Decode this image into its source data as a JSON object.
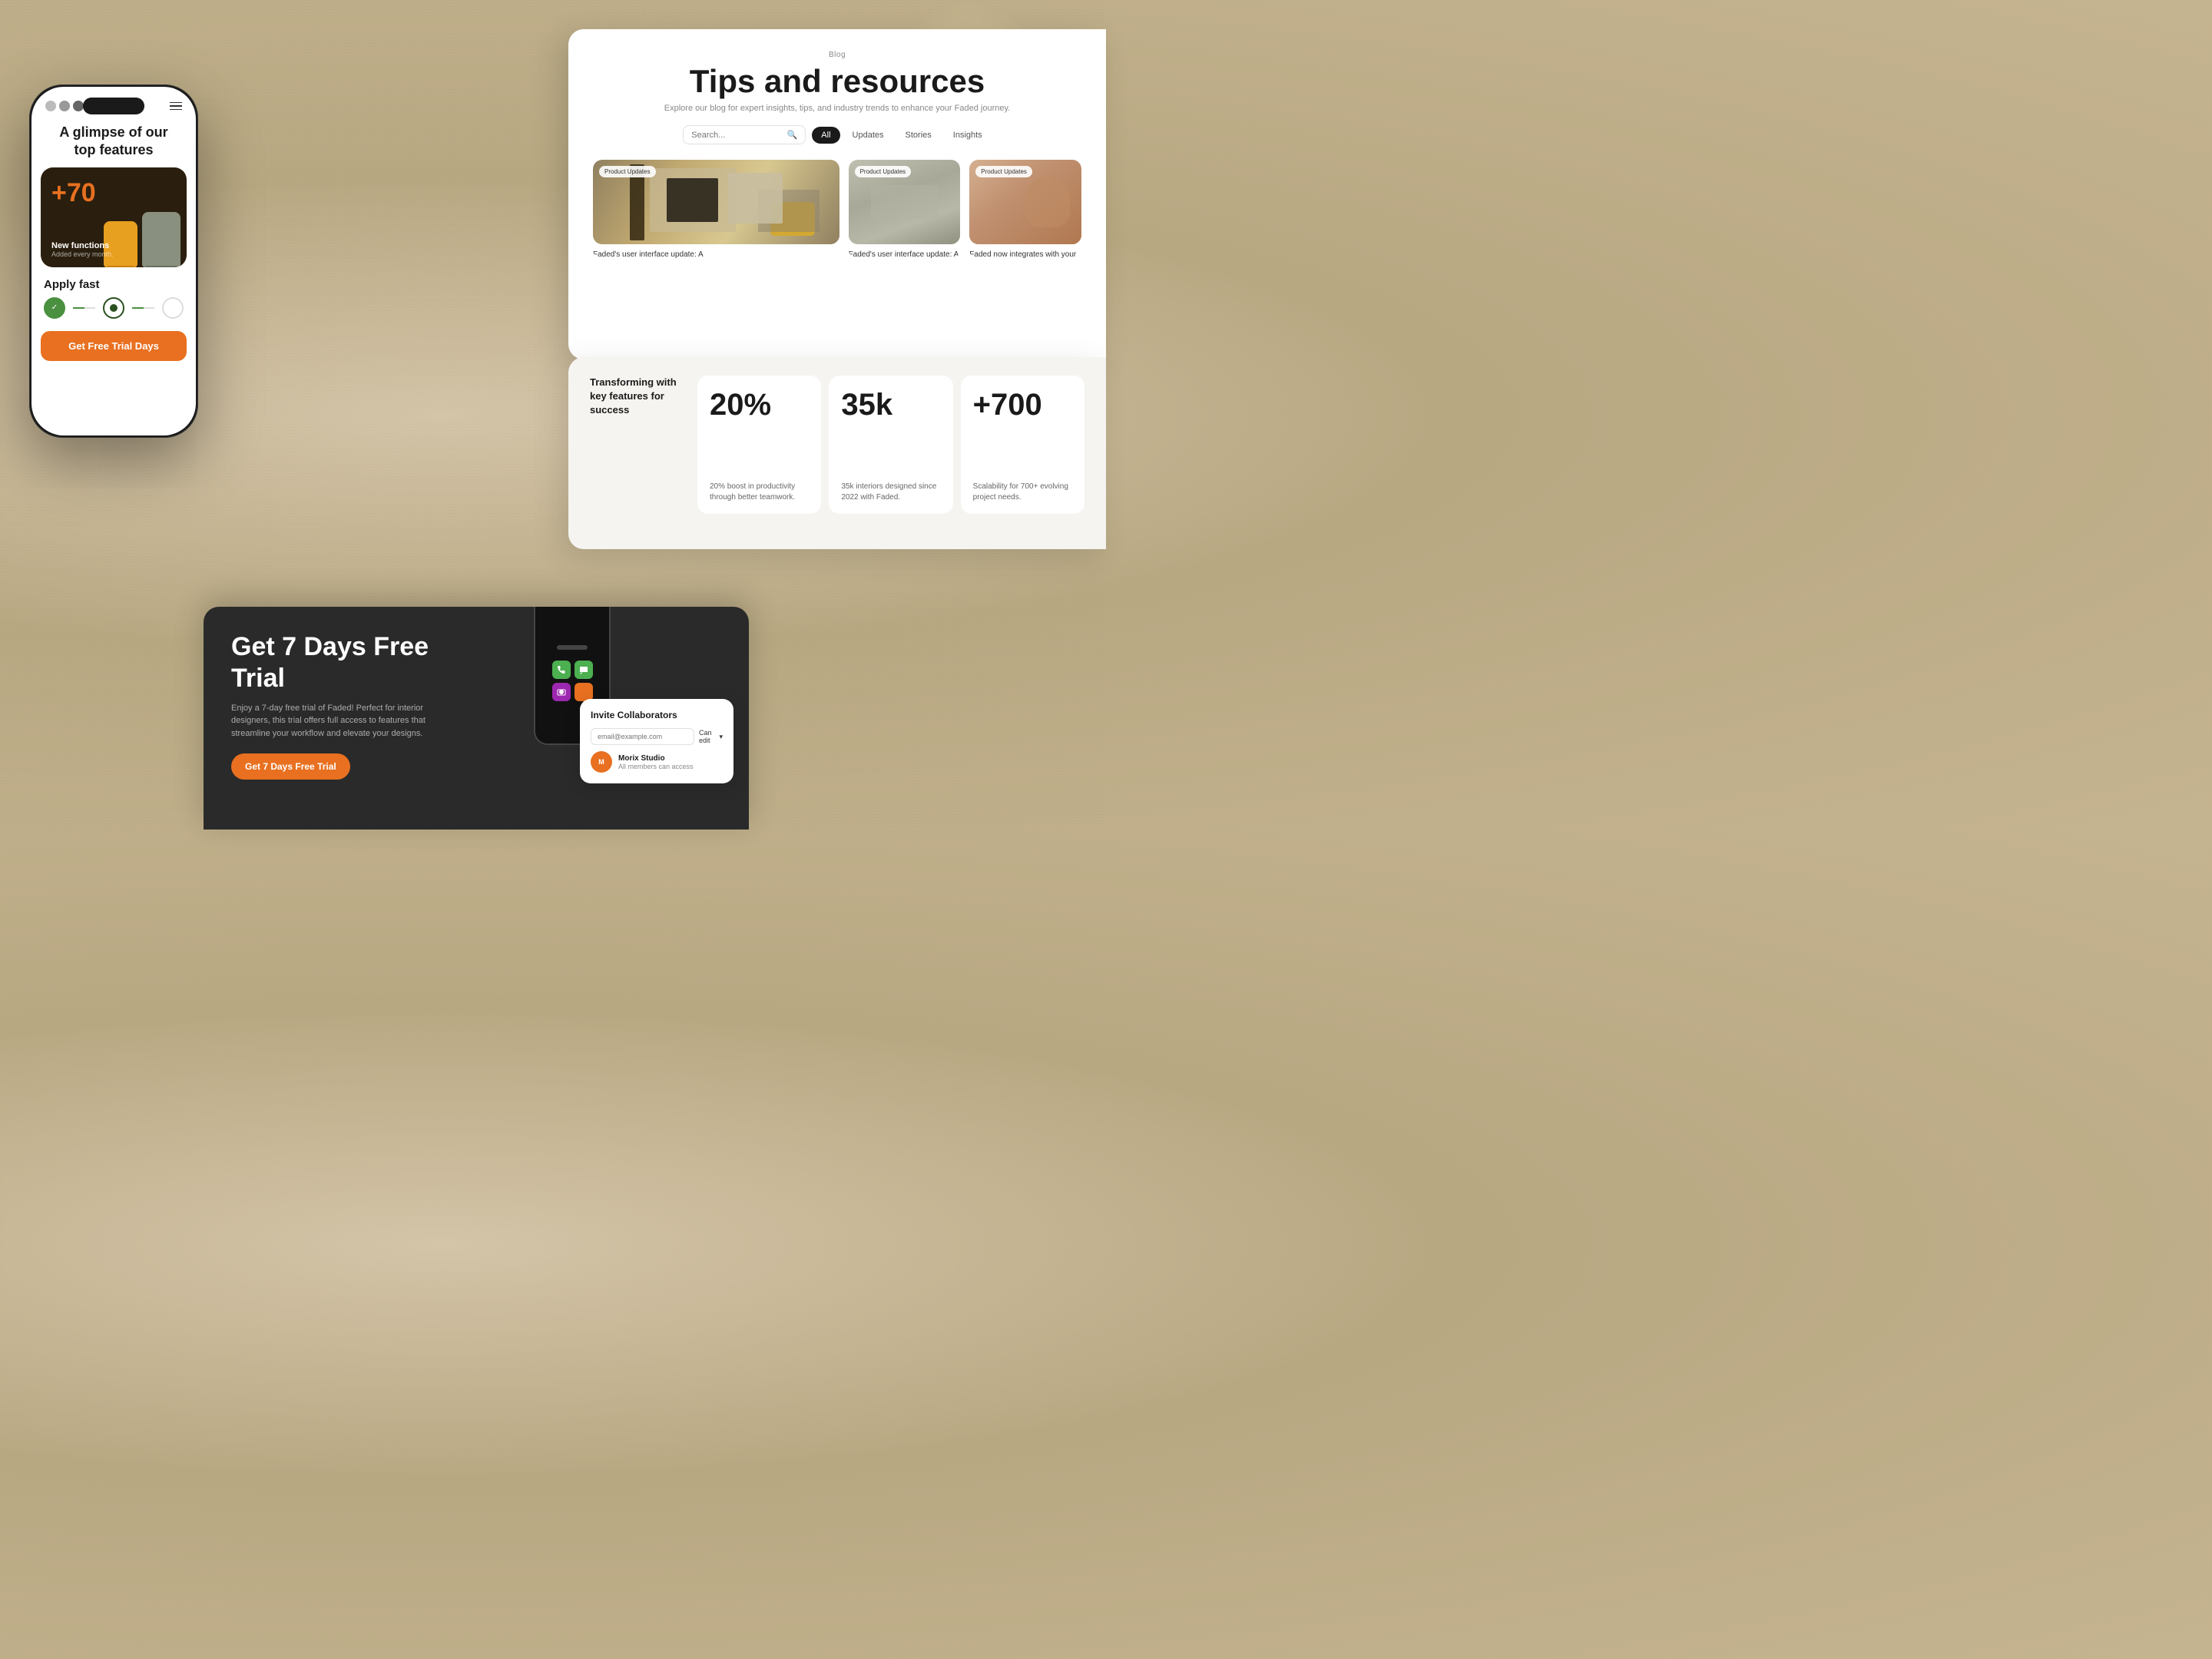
{
  "background": {
    "color": "#c8b99a"
  },
  "phone": {
    "dots": [
      "gray1",
      "gray2",
      "gray3",
      "dark"
    ],
    "heading": "A glimpse\nof our top features",
    "card": {
      "stat_prefix": "+",
      "stat_value": "70",
      "label_title": "New functions",
      "label_sub": "Added every month."
    },
    "apply_fast_label": "Apply fast",
    "cta_label": "Get Free Trial Days"
  },
  "blog": {
    "section_label": "Blog",
    "title": "Tips and resources",
    "subtitle": "Explore our blog for expert insights, tips, and industry trends to enhance your Faded journey.",
    "search_placeholder": "Search...",
    "filters": [
      "All",
      "Updates",
      "Stories",
      "Insights"
    ],
    "active_filter": "All",
    "cards": [
      {
        "badge": "Product Updates",
        "description": "Faded's user interface update: A"
      },
      {
        "badge": "Product Updates",
        "description": "Faded's user interface update: A"
      },
      {
        "badge": "Product Updates",
        "description": "Faded now integrates with your"
      }
    ]
  },
  "stats": {
    "left_text": "Transforming with key features for success",
    "items": [
      {
        "value": "20%",
        "description": "20% boost in productivity through better teamwork."
      },
      {
        "value": "35k",
        "description": "35k interiors designed since 2022 with Faded."
      },
      {
        "value": "+700",
        "description": "Scalability for 700+ evolving project needs."
      }
    ]
  },
  "cta": {
    "title": "Get 7 Days Free Trial",
    "subtitle": "Enjoy a 7-day free trial of Faded! Perfect for interior designers, this trial offers full access to features that streamline your workflow and elevate your designs.",
    "button_label": "Get 7 Days Free Trial"
  },
  "collaborators": {
    "title": "Invite Collaborators",
    "email_placeholder": "email@example.com",
    "permission_label": "Can edit",
    "user": {
      "name": "Morix Studio",
      "sub": "All members can access"
    }
  }
}
